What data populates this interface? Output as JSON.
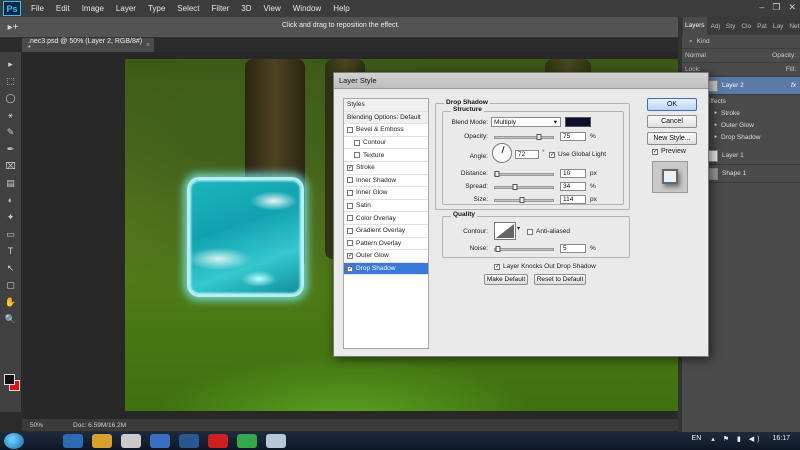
{
  "menubar": {
    "logo": "Ps",
    "items": [
      "File",
      "Edit",
      "Image",
      "Layer",
      "Type",
      "Select",
      "Filter",
      "3D",
      "View",
      "Window",
      "Help"
    ],
    "window_controls": [
      "–",
      "❐",
      "✕"
    ]
  },
  "options": {
    "tool_glyph": "▸+",
    "hint": "Click and drag to reposition the effect."
  },
  "document": {
    "tab_title": ".nec3.psd @ 50% (Layer 2, RGB/8#) *",
    "close": "×",
    "zoom": "50%",
    "doc_size": "Doc: 6.59M/16.2M"
  },
  "tools": [
    "▸",
    "⬚",
    "◯",
    "⚹",
    "✎",
    "✒",
    "⌧",
    "▤",
    "◐",
    "✦",
    "▭",
    "T",
    "↖",
    "▢",
    "✋",
    "🔍"
  ],
  "layers_panel": {
    "tabs": [
      "Layers",
      "Adj",
      "Sty",
      "Clo",
      "Pat",
      "Lay",
      "Net"
    ],
    "kind_label": "Kind",
    "blend_mode": "Normal",
    "opacity_label": "Opacity:",
    "lock_label": "Lock:",
    "fill_label": "Fill:",
    "layer2_name": "Layer 2",
    "fx": "fx",
    "effects_label": "Effects",
    "effects": [
      "Stroke",
      "Outer Glow",
      "Drop Shadow"
    ],
    "layer1_name": "Layer 1",
    "shape1_name": "Shape 1"
  },
  "dialog": {
    "title": "Layer Style",
    "styles": [
      {
        "label": "Styles",
        "checkbox": false,
        "checked": false,
        "selected": false,
        "indent": false,
        "header": true
      },
      {
        "label": "Blending Options: Default",
        "checkbox": false,
        "checked": false,
        "selected": false,
        "indent": false,
        "header": true
      },
      {
        "label": "Bevel & Emboss",
        "checkbox": true,
        "checked": false,
        "selected": false,
        "indent": false
      },
      {
        "label": "Contour",
        "checkbox": true,
        "checked": false,
        "selected": false,
        "indent": true
      },
      {
        "label": "Texture",
        "checkbox": true,
        "checked": false,
        "selected": false,
        "indent": true
      },
      {
        "label": "Stroke",
        "checkbox": true,
        "checked": true,
        "selected": false,
        "indent": false
      },
      {
        "label": "Inner Shadow",
        "checkbox": true,
        "checked": false,
        "selected": false,
        "indent": false
      },
      {
        "label": "Inner Glow",
        "checkbox": true,
        "checked": false,
        "selected": false,
        "indent": false
      },
      {
        "label": "Satin",
        "checkbox": true,
        "checked": false,
        "selected": false,
        "indent": false
      },
      {
        "label": "Color Overlay",
        "checkbox": true,
        "checked": false,
        "selected": false,
        "indent": false
      },
      {
        "label": "Gradient Overlay",
        "checkbox": true,
        "checked": false,
        "selected": false,
        "indent": false
      },
      {
        "label": "Pattern Overlay",
        "checkbox": true,
        "checked": false,
        "selected": false,
        "indent": false
      },
      {
        "label": "Outer Glow",
        "checkbox": true,
        "checked": true,
        "selected": false,
        "indent": false
      },
      {
        "label": "Drop Shadow",
        "checkbox": true,
        "checked": true,
        "selected": true,
        "indent": false
      }
    ],
    "drop_shadow": {
      "group_title": "Drop Shadow",
      "structure_title": "Structure",
      "blend_mode_label": "Blend Mode:",
      "blend_mode": "Multiply",
      "shadow_color": "#0a0f2e",
      "opacity_label": "Opacity:",
      "opacity": "75",
      "opacity_unit": "%",
      "opacity_fraction": 0.75,
      "angle_label": "Angle:",
      "angle": "72",
      "angle_unit": "°",
      "use_global_light": "Use Global Light",
      "distance_label": "Distance:",
      "distance": "10",
      "distance_unit": "px",
      "distance_fraction": 0.03,
      "spread_label": "Spread:",
      "spread": "34",
      "spread_unit": "%",
      "spread_fraction": 0.34,
      "size_label": "Size:",
      "size": "114",
      "size_unit": "px",
      "size_fraction": 0.46
    },
    "quality": {
      "group_title": "Quality",
      "contour_label": "Contour:",
      "anti_aliased": "Anti-aliased",
      "noise_label": "Noise:",
      "noise": "5",
      "noise_unit": "%",
      "noise_fraction": 0.05
    },
    "knockout": "Layer Knocks Out Drop Shadow",
    "make_default": "Make Default",
    "reset_default": "Reset to Default",
    "ok": "OK",
    "cancel": "Cancel",
    "new_style": "New Style...",
    "preview": "Preview"
  },
  "taskbar": {
    "lang": "EN",
    "time": "16:17",
    "apps": [
      "#2e6ab5",
      "#d8a12a",
      "#c9c9c9",
      "#3b6ec2",
      "#27598f",
      "#cf1f1f",
      "#34a94b",
      "#b7c7d9"
    ]
  }
}
